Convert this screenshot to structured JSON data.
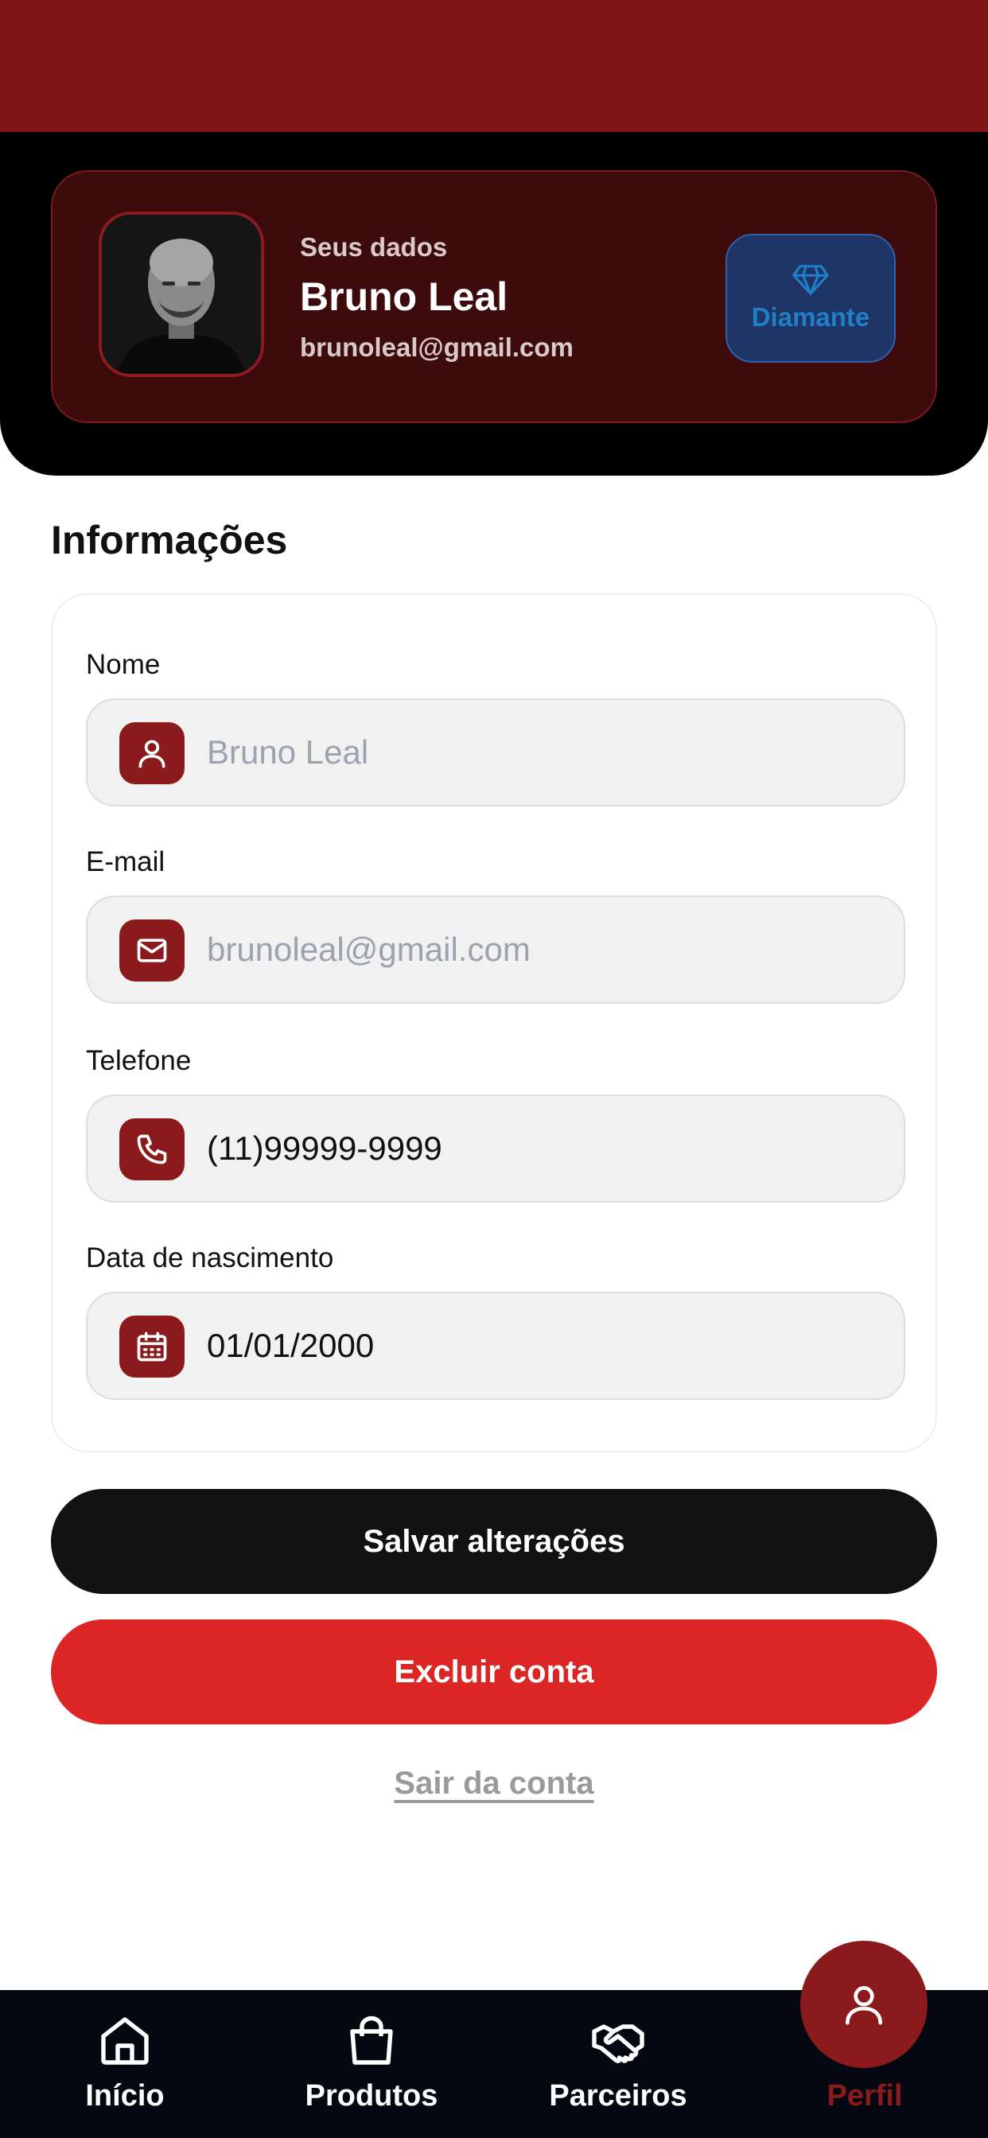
{
  "colors": {
    "brand_red": "#7f1616",
    "accent_red": "#8b1a1c",
    "danger": "#dc2626",
    "tier_blue": "#1f7fc9",
    "nav_bg": "#050810"
  },
  "profile": {
    "subtitle": "Seus dados",
    "name": "Bruno Leal",
    "email": "brunoleal@gmail.com",
    "tier": {
      "label": "Diamante",
      "icon": "diamond-icon"
    }
  },
  "info": {
    "title": "Informações",
    "fields": [
      {
        "label": "Nome",
        "value": "",
        "placeholder": "Bruno Leal",
        "icon": "user-icon"
      },
      {
        "label": "E-mail",
        "value": "",
        "placeholder": "brunoleal@gmail.com",
        "icon": "mail-icon"
      },
      {
        "label": "Telefone",
        "value": "(11)99999-9999",
        "icon": "phone-icon"
      },
      {
        "label": "Data de nascimento",
        "value": "01/01/2000",
        "icon": "calendar-icon"
      }
    ]
  },
  "actions": {
    "save_label": "Salvar alterações",
    "delete_label": "Excluir conta",
    "logout_label": "Sair da conta"
  },
  "nav": {
    "items": [
      {
        "label": "Início",
        "icon": "home-icon"
      },
      {
        "label": "Produtos",
        "icon": "shopping-bag-icon"
      },
      {
        "label": "Parceiros",
        "icon": "handshake-icon"
      },
      {
        "label": "Perfil",
        "icon": "user-icon",
        "active": true
      }
    ]
  }
}
